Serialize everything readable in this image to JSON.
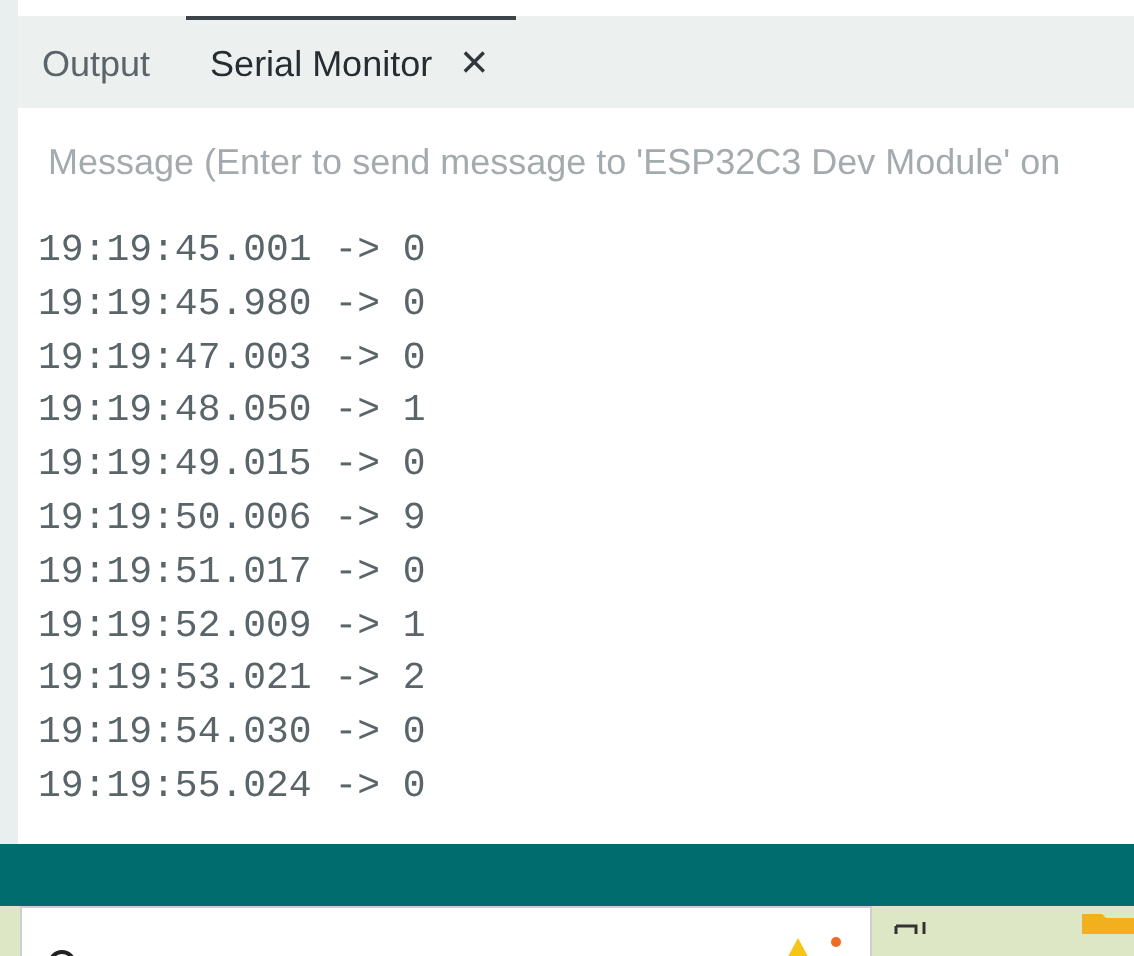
{
  "tabs": [
    {
      "label": "Output",
      "selected": false,
      "closable": false
    },
    {
      "label": "Serial Monitor",
      "selected": true,
      "closable": true
    }
  ],
  "close_glyph": "×",
  "message_field": {
    "placeholder": "Message (Enter to send message to 'ESP32C3 Dev Module' on"
  },
  "log_lines": [
    "19:19:45.001 -> 0",
    "19:19:45.980 -> 0",
    "19:19:47.003 -> 0",
    "19:19:48.050 -> 1",
    "19:19:49.015 -> 0",
    "19:19:50.006 -> 9",
    "19:19:51.017 -> 0",
    "19:19:52.009 -> 1",
    "19:19:53.021 -> 2",
    "19:19:54.030 -> 0",
    "19:19:55.024 -> 0"
  ]
}
